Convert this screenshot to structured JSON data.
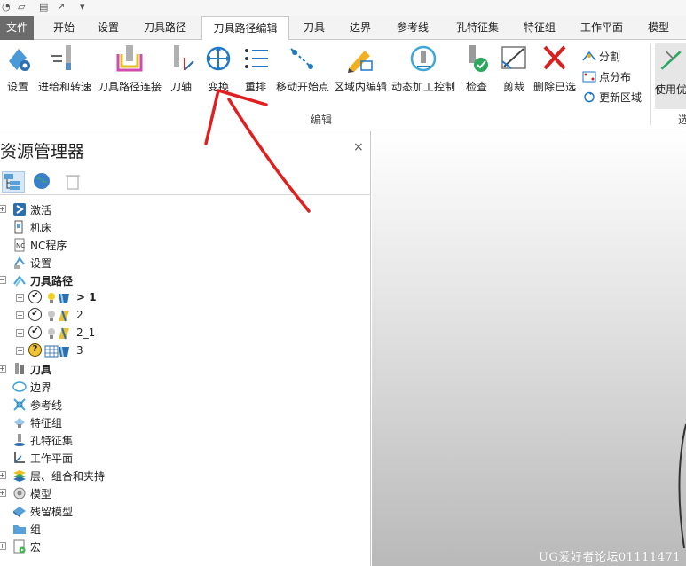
{
  "tabs": [
    {
      "label": "文件"
    },
    {
      "label": "开始"
    },
    {
      "label": "设置"
    },
    {
      "label": "刀具路径"
    },
    {
      "label": "刀具路径编辑"
    },
    {
      "label": "刀具"
    },
    {
      "label": "边界"
    },
    {
      "label": "参考线"
    },
    {
      "label": "孔特征集"
    },
    {
      "label": "特征组"
    },
    {
      "label": "工作平面"
    },
    {
      "label": "模型"
    }
  ],
  "active_tab": "刀具路径编辑",
  "ribbon": {
    "buttons": [
      {
        "label": "设置",
        "icon": "setup-icon"
      },
      {
        "label": "进给和转速",
        "icon": "feed-speed-icon"
      },
      {
        "label": "刀具路径连接",
        "icon": "toolpath-link-icon"
      },
      {
        "label": "刀轴",
        "icon": "tool-axis-icon"
      },
      {
        "label": "变换",
        "icon": "transform-icon"
      },
      {
        "label": "重排",
        "icon": "reorder-icon"
      },
      {
        "label": "移动开始点",
        "icon": "move-start-point-icon"
      },
      {
        "label": "区域内编辑",
        "icon": "edit-region-icon"
      },
      {
        "label": "动态加工控制",
        "icon": "dynamic-control-icon"
      },
      {
        "label": "检查",
        "icon": "check-icon"
      },
      {
        "label": "剪裁",
        "icon": "trim-icon"
      },
      {
        "label": "删除已选",
        "icon": "delete-selected-icon"
      }
    ],
    "small_buttons": [
      {
        "label": "分割",
        "icon": "split-icon"
      },
      {
        "label": "点分布",
        "icon": "point-distribution-icon"
      },
      {
        "label": "更新区域",
        "icon": "update-region-icon"
      }
    ],
    "group_label": "编辑",
    "partial_button_label": "使用优",
    "partial_group_label": "选"
  },
  "explorer": {
    "title": "资源管理器",
    "close": "×",
    "tree": [
      {
        "label": "激活",
        "icon": "activate-icon",
        "bold": false
      },
      {
        "label": "机床",
        "icon": "machine-icon",
        "bold": false
      },
      {
        "label": "NC程序",
        "icon": "nc-program-icon",
        "bold": false
      },
      {
        "label": "设置",
        "icon": "setup-icon",
        "bold": false
      },
      {
        "label": "刀具路径",
        "icon": "toolpaths-icon",
        "bold": true
      },
      {
        "label": "> 1",
        "state": "✔",
        "bold": true
      },
      {
        "label": "2",
        "state": "✔",
        "bold": false
      },
      {
        "label": "2_1",
        "state": "✔",
        "bold": false
      },
      {
        "label": "3",
        "state": "?",
        "bold": false
      },
      {
        "label": "刀具",
        "icon": "tools-icon",
        "bold": true
      },
      {
        "label": "边界",
        "icon": "boundary-icon",
        "bold": false
      },
      {
        "label": "参考线",
        "icon": "pattern-icon",
        "bold": false
      },
      {
        "label": "特征组",
        "icon": "feature-group-icon",
        "bold": false
      },
      {
        "label": "孔特征集",
        "icon": "hole-feature-icon",
        "bold": false
      },
      {
        "label": "工作平面",
        "icon": "workplane-icon",
        "bold": false
      },
      {
        "label": "层、组合和夹持",
        "icon": "layers-icon",
        "bold": false
      },
      {
        "label": "模型",
        "icon": "model-icon",
        "bold": false
      },
      {
        "label": "残留模型",
        "icon": "stock-model-icon",
        "bold": false
      },
      {
        "label": "组",
        "icon": "group-icon",
        "bold": false
      },
      {
        "label": "宏",
        "icon": "macro-icon",
        "bold": false
      }
    ]
  },
  "watermark": "UG爱好者论坛01111471",
  "colors": {
    "file_tab": "#6b6b6b",
    "accent_blue": "#1f78c8",
    "annotation_arrow": "#e02020"
  }
}
